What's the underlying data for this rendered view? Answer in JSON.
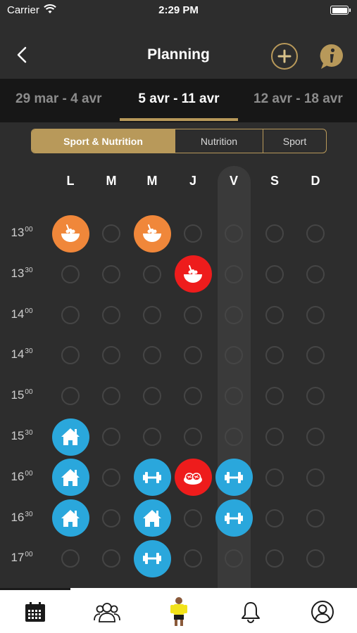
{
  "status_bar": {
    "carrier": "Carrier",
    "time": "2:29 PM"
  },
  "header": {
    "title": "Planning"
  },
  "weeks": {
    "previous": "29 mar - 4 avr",
    "current": "5 avr - 11 avr",
    "next": "12 avr - 18 avr"
  },
  "filters": {
    "selected": "Sport & Nutrition",
    "options": [
      "Sport & Nutrition",
      "Nutrition",
      "Sport"
    ]
  },
  "days": [
    "L",
    "M",
    "M",
    "J",
    "V",
    "S",
    "D"
  ],
  "today_index": 4,
  "times": [
    {
      "h": "13",
      "m": "00"
    },
    {
      "h": "13",
      "m": "30"
    },
    {
      "h": "14",
      "m": "00"
    },
    {
      "h": "14",
      "m": "30"
    },
    {
      "h": "15",
      "m": "00"
    },
    {
      "h": "15",
      "m": "30"
    },
    {
      "h": "16",
      "m": "00"
    },
    {
      "h": "16",
      "m": "30"
    },
    {
      "h": "17",
      "m": "00"
    }
  ],
  "colors": {
    "gold": "#b8995a",
    "orange": "#f0873a",
    "red": "#ee1c1c",
    "blue": "#2aa7dc",
    "slot": "#454545"
  },
  "events": [
    {
      "day": 0,
      "time": 0,
      "kind": "meal-bowl-icon",
      "color": "#f0873a"
    },
    {
      "day": 2,
      "time": 0,
      "kind": "meal-bowl-icon",
      "color": "#f0873a"
    },
    {
      "day": 3,
      "time": 1,
      "kind": "meal-bowl-icon",
      "color": "#ee1c1c"
    },
    {
      "day": 0,
      "time": 5,
      "kind": "home-icon",
      "color": "#2aa7dc"
    },
    {
      "day": 0,
      "time": 6,
      "kind": "home-icon",
      "color": "#2aa7dc"
    },
    {
      "day": 2,
      "time": 6,
      "kind": "dumbbell-icon",
      "color": "#2aa7dc"
    },
    {
      "day": 3,
      "time": 6,
      "kind": "food-plate-icon",
      "color": "#ee1c1c"
    },
    {
      "day": 4,
      "time": 6,
      "kind": "dumbbell-icon",
      "color": "#2aa7dc"
    },
    {
      "day": 0,
      "time": 7,
      "kind": "home-icon",
      "color": "#2aa7dc"
    },
    {
      "day": 2,
      "time": 7,
      "kind": "home-icon",
      "color": "#2aa7dc"
    },
    {
      "day": 4,
      "time": 7,
      "kind": "dumbbell-icon",
      "color": "#2aa7dc"
    },
    {
      "day": 2,
      "time": 8,
      "kind": "dumbbell-icon",
      "color": "#2aa7dc"
    }
  ],
  "tabs": [
    {
      "icon": "calendar-icon",
      "active": true
    },
    {
      "icon": "community-icon",
      "active": false
    },
    {
      "icon": "coach-avatar-icon",
      "active": false
    },
    {
      "icon": "bell-icon",
      "active": false
    },
    {
      "icon": "profile-icon",
      "active": false
    }
  ]
}
